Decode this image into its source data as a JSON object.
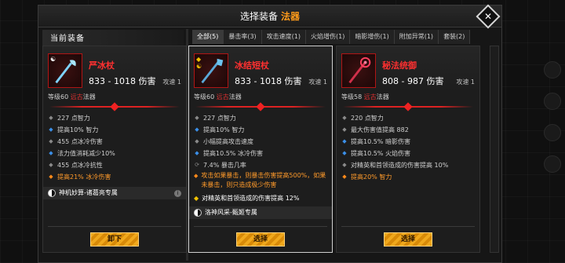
{
  "header": {
    "title": "选择装备",
    "category": "法器"
  },
  "current_title": "当前装备",
  "tabs": [
    "全部(5)",
    "暴击率(3)",
    "攻击速度(1)",
    "火焰增伤(1)",
    "暗影增伤(1)",
    "附加异常(1)",
    "套装(2)"
  ],
  "cards": [
    {
      "name": "严冰杖",
      "dmg": "833 - 1018 伤害",
      "atk": "攻速 1",
      "level": "等级60",
      "quality": "远古",
      "type": "法器",
      "stats": [
        {
          "b": "◆",
          "c": "gray",
          "t": "227 点智力"
        },
        {
          "b": "◆",
          "c": "blue",
          "t": "提高10% 智力"
        },
        {
          "b": "◆",
          "c": "gray",
          "t": "455 点冰冷伤害"
        },
        {
          "b": "◆",
          "c": "blue",
          "t": "法力值消耗减少10%"
        },
        {
          "b": "◆",
          "c": "gray",
          "t": "455 点冰冷抗性"
        },
        {
          "b": "◆",
          "c": "orange",
          "t": "提高21% 冰冷伤害",
          "orange": true
        }
      ],
      "set": "神机妙算-诸葛亮专属",
      "button": "卸下"
    },
    {
      "name": "冰结短杖",
      "dmg": "833 - 1018 伤害",
      "atk": "攻速 1",
      "level": "等级60",
      "quality": "远古",
      "type": "法器",
      "stats": [
        {
          "b": "◆",
          "c": "gray",
          "t": "227 点智力"
        },
        {
          "b": "◆",
          "c": "blue",
          "t": "提高10% 智力"
        },
        {
          "b": "◆",
          "c": "gray",
          "t": "小幅提高攻击速度"
        },
        {
          "b": "◆",
          "c": "blue",
          "t": "提高10.5% 冰冷伤害"
        },
        {
          "b": "⟳",
          "c": "gray",
          "t": "7.4% 暴击几率"
        },
        {
          "b": "◆",
          "c": "orange",
          "t": "攻击如果暴击，则暴击伤害提高500%，如果未暴击，则只造成极少伤害",
          "orange": true,
          "two": true
        }
      ],
      "extra": "对精英和首领造成的伤害提高 12%",
      "set": "洛神风采-甄姬专属",
      "button": "选择"
    },
    {
      "name": "秘法统御",
      "dmg": "808 - 987 伤害",
      "atk": "攻速 1",
      "level": "等级58",
      "quality": "远古",
      "type": "法器",
      "stats": [
        {
          "b": "◆",
          "c": "gray",
          "t": "220 点智力"
        },
        {
          "b": "◆",
          "c": "gray",
          "t": "最大伤害值提高 882"
        },
        {
          "b": "◆",
          "c": "blue",
          "t": "提高10.5% 暗影伤害"
        },
        {
          "b": "◆",
          "c": "blue",
          "t": "提高10.5% 火焰伤害"
        },
        {
          "b": "◆",
          "c": "gray",
          "t": "对精英和首领造成的伤害提高 10%"
        },
        {
          "b": "◆",
          "c": "orange",
          "t": "提高20% 智力",
          "orange": true
        }
      ],
      "button": "选择"
    }
  ],
  "colors": {
    "accent": "#ff9b1a",
    "rare_red": "#ff3030",
    "button": "#f0a81c"
  }
}
